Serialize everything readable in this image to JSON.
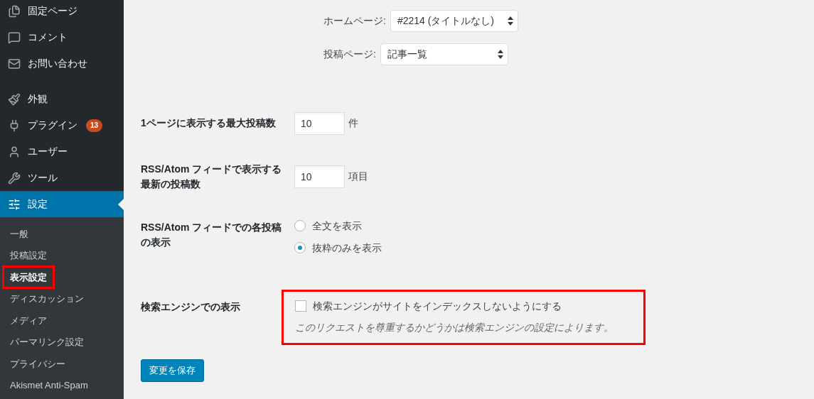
{
  "sidebar": {
    "menu": [
      {
        "label": "固定ページ",
        "selected": false
      },
      {
        "label": "コメント",
        "selected": false
      },
      {
        "label": "お問い合わせ",
        "selected": false
      },
      {
        "kind": "separator"
      },
      {
        "label": "外観",
        "selected": false
      },
      {
        "label": "プラグイン",
        "selected": false,
        "badge": "13"
      },
      {
        "label": "ユーザー",
        "selected": false
      },
      {
        "label": "ツール",
        "selected": false
      },
      {
        "label": "設定",
        "selected": true
      }
    ],
    "submenu": [
      {
        "label": "一般",
        "selected": false,
        "highlighted": false
      },
      {
        "label": "投稿設定",
        "selected": false,
        "highlighted": false
      },
      {
        "label": "表示設定",
        "selected": true,
        "highlighted": true
      },
      {
        "label": "ディスカッション",
        "selected": false,
        "highlighted": false
      },
      {
        "label": "メディア",
        "selected": false,
        "highlighted": false
      },
      {
        "label": "パーマリンク設定",
        "selected": false,
        "highlighted": false
      },
      {
        "label": "プライバシー",
        "selected": false,
        "highlighted": false
      },
      {
        "label": "Akismet Anti-Spam",
        "selected": false,
        "highlighted": false
      }
    ]
  },
  "front_page": [
    {
      "label": "ホームページ:",
      "value": "#2214 (タイトルなし)"
    },
    {
      "label": "投稿ページ:",
      "value": "記事一覧"
    }
  ],
  "settings": [
    {
      "kind": "number",
      "label": "1ページに表示する最大投稿数",
      "value": "10",
      "unit": "件"
    },
    {
      "kind": "number",
      "label": "RSS/Atom フィードで表示する最新の投稿数",
      "value": "10",
      "unit": "項目"
    },
    {
      "kind": "radio",
      "label": "RSS/Atom フィードでの各投稿の表示",
      "options": [
        {
          "label": "全文を表示",
          "selected": false
        },
        {
          "label": "抜粋のみを表示",
          "selected": true
        }
      ]
    },
    {
      "kind": "checkbox",
      "label": "検索エンジンでの表示",
      "checkbox_label": "検索エンジンがサイトをインデックスしないようにする",
      "checked": false,
      "description": "このリクエストを尊重するかどうかは検索エンジンの設定によります。",
      "highlighted": true
    }
  ],
  "save_button": "変更を保存"
}
